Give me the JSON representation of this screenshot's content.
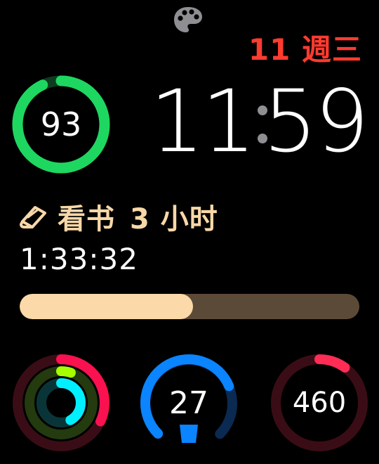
{
  "date": {
    "text": "11 週三",
    "color": "#ff3b30"
  },
  "battery": {
    "value": "93",
    "fraction": 0.93,
    "color": "#1ed760"
  },
  "time": {
    "hours": "11",
    "minutes": "59"
  },
  "task": {
    "icon": "book-icon",
    "title": "看书",
    "goal_number": "3",
    "goal_unit": "小时",
    "elapsed": "1:33:32",
    "progress": 0.51,
    "accent": "#fcd9a8"
  },
  "activity": {
    "move_fraction": 0.32,
    "exercise_fraction": 0.05,
    "stand_fraction": 0.42,
    "colors": {
      "move": "#fa114f",
      "exercise": "#a6ff00",
      "stand": "#00f0ff"
    }
  },
  "stand_gauge": {
    "value": "27",
    "fraction": 0.75,
    "color": "#0a84ff"
  },
  "calories": {
    "value": "460",
    "fraction": 0.1,
    "color": "#ff2d55"
  },
  "icons": {
    "top": "palette-icon"
  }
}
